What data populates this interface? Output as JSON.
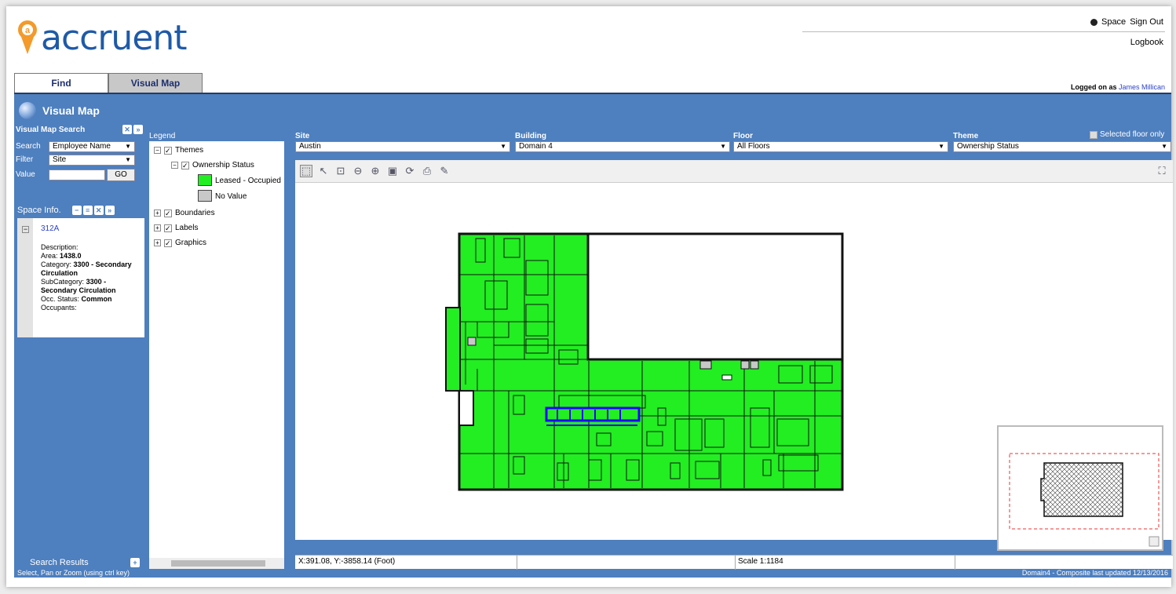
{
  "brand": {
    "name": "accruent"
  },
  "header": {
    "space": "Space",
    "signout": "Sign Out",
    "logbook": "Logbook",
    "logged_prefix": "Logged on as",
    "user": "James Millican"
  },
  "tabs": [
    "Find",
    "Visual Map"
  ],
  "visual_map": {
    "title": "Visual Map"
  },
  "search": {
    "header": "Visual Map Search",
    "search_label": "Search",
    "search_value": "Employee Name",
    "filter_label": "Filter",
    "filter_value": "Site",
    "value_label": "Value",
    "go": "GO"
  },
  "space_info": {
    "header": "Space Info.",
    "id": "312A",
    "desc_label": "Description:",
    "area_label": "Area:",
    "area": "1438.0",
    "category_label": "Category:",
    "category": "3300 - Secondary Circulation",
    "subcategory_label": "SubCategory:",
    "subcategory": "3300 - Secondary Circulation",
    "occ_label": "Occ. Status:",
    "occ": "Common",
    "occupants_label": "Occupants:"
  },
  "search_results": "Search Results",
  "legend": {
    "header": "Legend",
    "themes": "Themes",
    "ownership": "Ownership Status",
    "leased": "Leased - Occupied",
    "novalue": "No Value",
    "boundaries": "Boundaries",
    "labels": "Labels",
    "graphics": "Graphics",
    "colors": {
      "leased": "#22ee22",
      "novalue": "#c8c8c8"
    }
  },
  "filters": {
    "site_label": "Site",
    "site": "Austin",
    "building_label": "Building",
    "building": "Domain 4",
    "floor_label": "Floor",
    "floor": "All Floors",
    "theme_label": "Theme",
    "theme": "Ownership Status",
    "selected_floor_only": "Selected floor only"
  },
  "map_status": {
    "coords": "X:391.08, Y:-3858.14 (Foot)",
    "scale": "Scale 1:1184"
  },
  "status": {
    "left": "Select, Pan or Zoom (using ctrl key)",
    "right": "Domain4 - Composite last updated 12/13/2016"
  },
  "colors": {
    "panel": "#4e7fbe",
    "highlight": "#2200ff"
  }
}
